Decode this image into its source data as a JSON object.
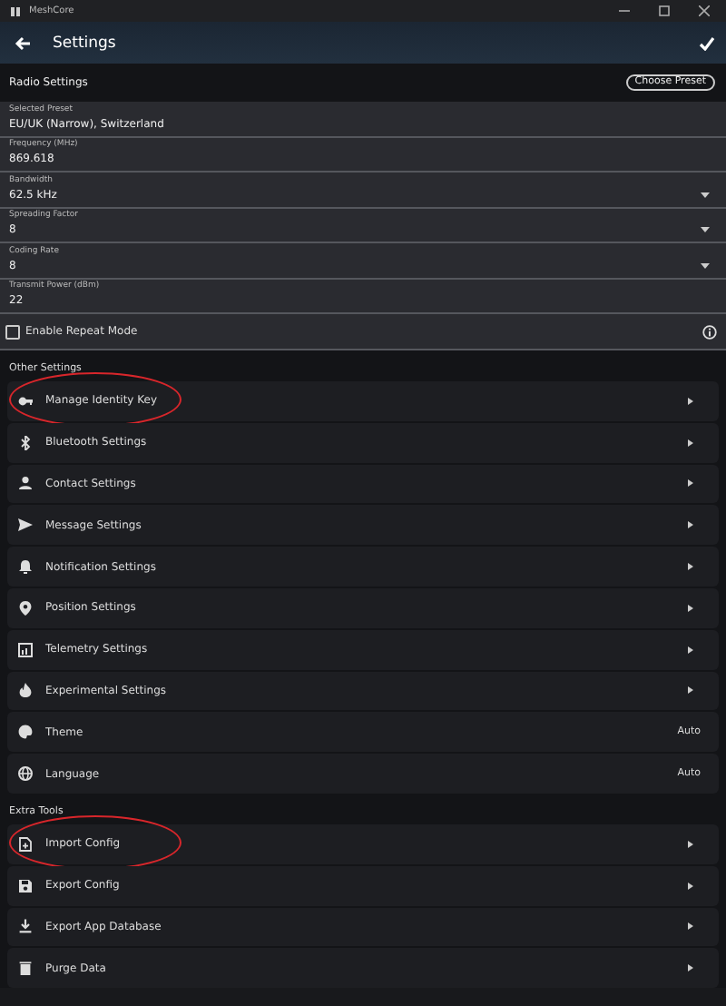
{
  "window": {
    "title": "MeshCore"
  },
  "app_bar": {
    "title": "Settings"
  },
  "radio_settings": {
    "title": "Radio Settings",
    "preset_button": "Choose Preset",
    "fields": [
      {
        "label": "Selected Preset",
        "value": "EU/UK (Narrow), Switzerland",
        "kind": "text"
      },
      {
        "label": "Frequency (MHz)",
        "value": "869.618",
        "kind": "text"
      },
      {
        "label": "Bandwidth",
        "value": "62.5 kHz",
        "kind": "dropdown"
      },
      {
        "label": "Spreading Factor",
        "value": "8",
        "kind": "dropdown"
      },
      {
        "label": "Coding Rate",
        "value": "8",
        "kind": "dropdown"
      },
      {
        "label": "Transmit Power (dBm)",
        "value": "22",
        "kind": "text"
      }
    ],
    "repeat_mode": {
      "label": "Enable Repeat Mode",
      "checked": false
    }
  },
  "sections": [
    {
      "title": "Other Settings",
      "items": [
        {
          "label": "Manage Identity Key",
          "highlighted": true
        },
        {
          "label": "Bluetooth Settings",
          "highlighted": false
        },
        {
          "label": "Contact Settings",
          "highlighted": false
        },
        {
          "label": "Message Settings",
          "highlighted": false
        },
        {
          "label": "Notification Settings",
          "highlighted": false
        },
        {
          "label": "Position Settings",
          "highlighted": false
        },
        {
          "label": "Telemetry Settings",
          "highlighted": false
        },
        {
          "label": "Experimental Settings",
          "highlighted": false
        },
        {
          "label": "Theme",
          "value": "Auto",
          "highlighted": false
        },
        {
          "label": "Language",
          "value": "Auto",
          "highlighted": false
        }
      ]
    },
    {
      "title": "Extra Tools",
      "items": [
        {
          "label": "Import Config",
          "highlighted": true
        },
        {
          "label": "Export Config",
          "highlighted": false
        },
        {
          "label": "Export App Database",
          "highlighted": false
        },
        {
          "label": "Purge Data",
          "highlighted": false
        }
      ]
    }
  ]
}
